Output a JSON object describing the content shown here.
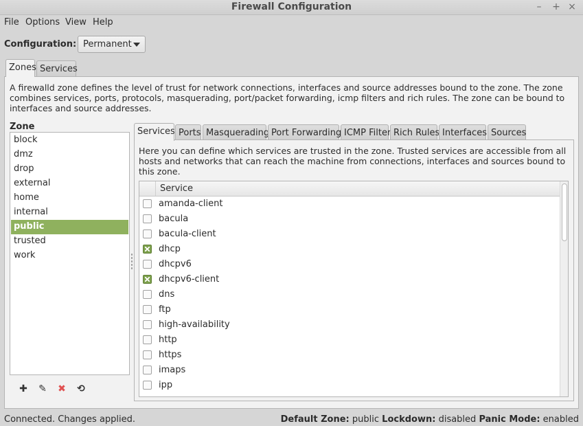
{
  "window": {
    "title": "Firewall Configuration",
    "controls": [
      "–",
      "+",
      "×"
    ]
  },
  "menu": [
    "File",
    "Options",
    "View",
    "Help"
  ],
  "configuration": {
    "label": "Configuration:",
    "value": "Permanent"
  },
  "top_tabs": [
    {
      "label": "Zones",
      "active": true
    },
    {
      "label": "Services",
      "active": false
    }
  ],
  "zone_description": "A firewalld zone defines the level of trust for network connections, interfaces and source addresses bound to the zone. The zone combines services, ports, protocols, masquerading, port/packet forwarding, icmp filters and rich rules. The zone can be bound to interfaces and source addresses.",
  "zone_panel": {
    "label": "Zone",
    "zones": [
      "block",
      "dmz",
      "drop",
      "external",
      "home",
      "internal",
      "public",
      "trusted",
      "work"
    ],
    "selected": "public",
    "tools": [
      {
        "name": "add-icon",
        "glyph": "✚",
        "color": "#333333"
      },
      {
        "name": "edit-icon",
        "glyph": "✎",
        "color": "#333333"
      },
      {
        "name": "remove-icon",
        "glyph": "✖",
        "color": "#e05050"
      },
      {
        "name": "load-defaults-icon",
        "glyph": "⟲",
        "color": "#333333"
      }
    ]
  },
  "inner_tabs": [
    {
      "label": "Services",
      "active": true
    },
    {
      "label": "Ports",
      "active": false
    },
    {
      "label": "Masquerading",
      "active": false
    },
    {
      "label": "Port Forwarding",
      "active": false
    },
    {
      "label": "ICMP Filter",
      "active": false
    },
    {
      "label": "Rich Rules",
      "active": false
    },
    {
      "label": "Interfaces",
      "active": false
    },
    {
      "label": "Sources",
      "active": false
    }
  ],
  "services_description": "Here you can define which services are trusted in the zone. Trusted services are accessible from all hosts and networks that can reach the machine from connections, interfaces and sources bound to this zone.",
  "services_table": {
    "column": "Service",
    "rows": [
      {
        "name": "amanda-client",
        "checked": false
      },
      {
        "name": "bacula",
        "checked": false
      },
      {
        "name": "bacula-client",
        "checked": false
      },
      {
        "name": "dhcp",
        "checked": true
      },
      {
        "name": "dhcpv6",
        "checked": false
      },
      {
        "name": "dhcpv6-client",
        "checked": true
      },
      {
        "name": "dns",
        "checked": false
      },
      {
        "name": "ftp",
        "checked": false
      },
      {
        "name": "high-availability",
        "checked": false
      },
      {
        "name": "http",
        "checked": false
      },
      {
        "name": "https",
        "checked": false
      },
      {
        "name": "imaps",
        "checked": false
      },
      {
        "name": "ipp",
        "checked": false
      }
    ]
  },
  "status": {
    "left": "Connected.  Changes applied.",
    "default_zone_label": "Default Zone:",
    "default_zone": "public",
    "lockdown_label": "Lockdown:",
    "lockdown": "disabled",
    "panic_label": "Panic Mode:",
    "panic": "enabled"
  },
  "colors": {
    "selection": "#8fb15e",
    "checkbox_checked": "#7fa24f"
  }
}
